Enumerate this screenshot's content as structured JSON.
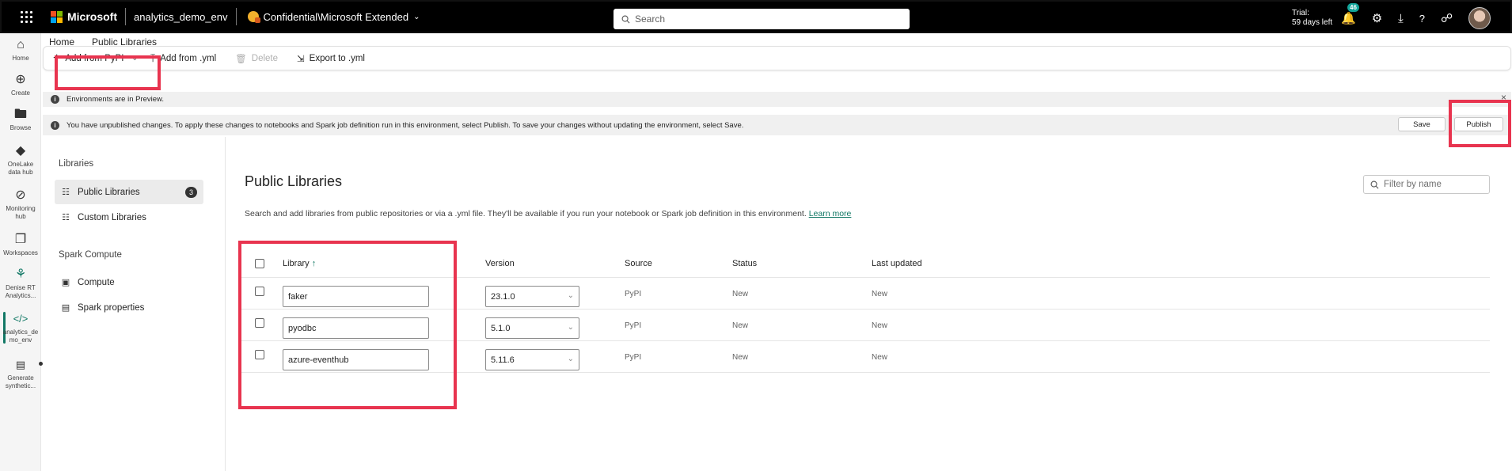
{
  "topbar": {
    "brand": "Microsoft",
    "env_name": "analytics_demo_env",
    "sensitivity": "Confidential\\Microsoft Extended",
    "search_placeholder": "Search",
    "trial_line1": "Trial:",
    "trial_line2": "59 days left",
    "notifications_count": "46"
  },
  "rail": {
    "home": "Home",
    "create": "Create",
    "browse": "Browse",
    "onelake_1": "OneLake",
    "onelake_2": "data hub",
    "monitoring_1": "Monitoring",
    "monitoring_2": "hub",
    "workspaces": "Workspaces",
    "denise_1": "Denise RT",
    "denise_2": "Analytics...",
    "analytics_1": "analytics_de",
    "analytics_2": "mo_env",
    "generate_1": "Generate",
    "generate_2": "synthetic..."
  },
  "tabs": [
    "Home",
    "Public Libraries"
  ],
  "ribbon": {
    "add_pypi": "Add from PyPI",
    "add_yml": "Add from .yml",
    "delete": "Delete",
    "export_yml": "Export to .yml"
  },
  "messages": {
    "preview": "Environments are in Preview.",
    "unpublished": "You have unpublished changes. To apply these changes to notebooks and Spark job definition run in this environment, select Publish. To save your changes without updating the environment, select Save.",
    "save": "Save",
    "publish": "Publish"
  },
  "sidepanel": {
    "libraries_heading": "Libraries",
    "public_libraries": "Public Libraries",
    "public_count": "3",
    "custom_libraries": "Custom Libraries",
    "spark_heading": "Spark Compute",
    "compute": "Compute",
    "spark_properties": "Spark properties"
  },
  "main": {
    "title": "Public Libraries",
    "filter_placeholder": "Filter by name",
    "description": "Search and add libraries from public repositories or via a .yml file. They'll be available if you run your notebook or Spark job definition in this environment.",
    "learn_more": "Learn more",
    "columns": {
      "library": "Library",
      "sort_arrow": "↑",
      "version": "Version",
      "source": "Source",
      "status": "Status",
      "last_updated": "Last updated"
    },
    "rows": [
      {
        "library": "faker",
        "version": "23.1.0",
        "source": "PyPI",
        "status": "New",
        "last_updated": "New"
      },
      {
        "library": "pyodbc",
        "version": "5.1.0",
        "source": "PyPI",
        "status": "New",
        "last_updated": "New"
      },
      {
        "library": "azure-eventhub",
        "version": "5.11.6",
        "source": "PyPI",
        "status": "New",
        "last_updated": "New"
      }
    ]
  },
  "colors": {
    "accent": "#117865",
    "highlight": "#e8344f",
    "topbar": "#000000"
  }
}
